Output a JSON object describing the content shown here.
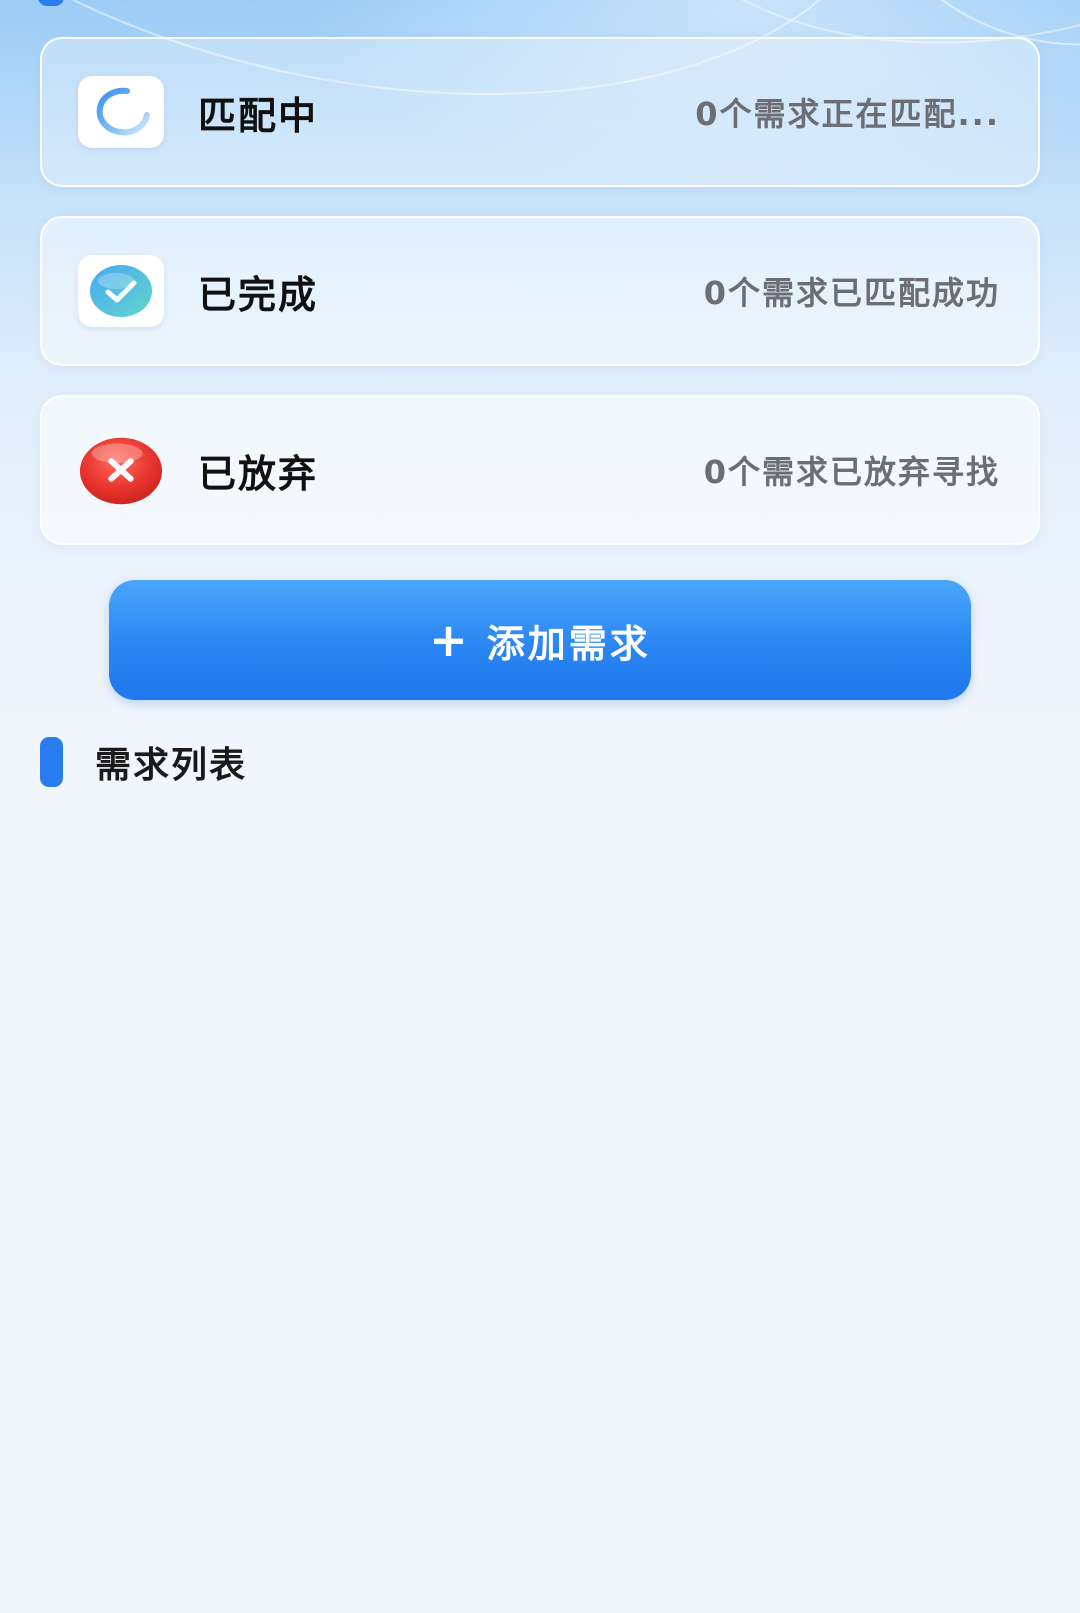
{
  "status_cards": [
    {
      "id": "matching",
      "title": "匹配中",
      "description": "0个需求正在匹配...",
      "icon": "loading-spinner-icon"
    },
    {
      "id": "completed",
      "title": "已完成",
      "description": "0个需求已匹配成功",
      "icon": "check-circle-icon"
    },
    {
      "id": "abandoned",
      "title": "已放弃",
      "description": "0个需求已放弃寻找",
      "icon": "red-x-circle-icon"
    }
  ],
  "add_button": {
    "icon": "plus-icon",
    "label": "添加需求"
  },
  "section": {
    "title": "需求列表"
  },
  "colors": {
    "accent": "#2a7df0",
    "button_top": "#4aa6fa",
    "button_bottom": "#1f78ee",
    "page_background": "#f1f5fc",
    "description_text": "#6b6e74",
    "title_text": "#111111",
    "abandon_red": "#e8352e",
    "check_teal": "#4fc3e8"
  }
}
